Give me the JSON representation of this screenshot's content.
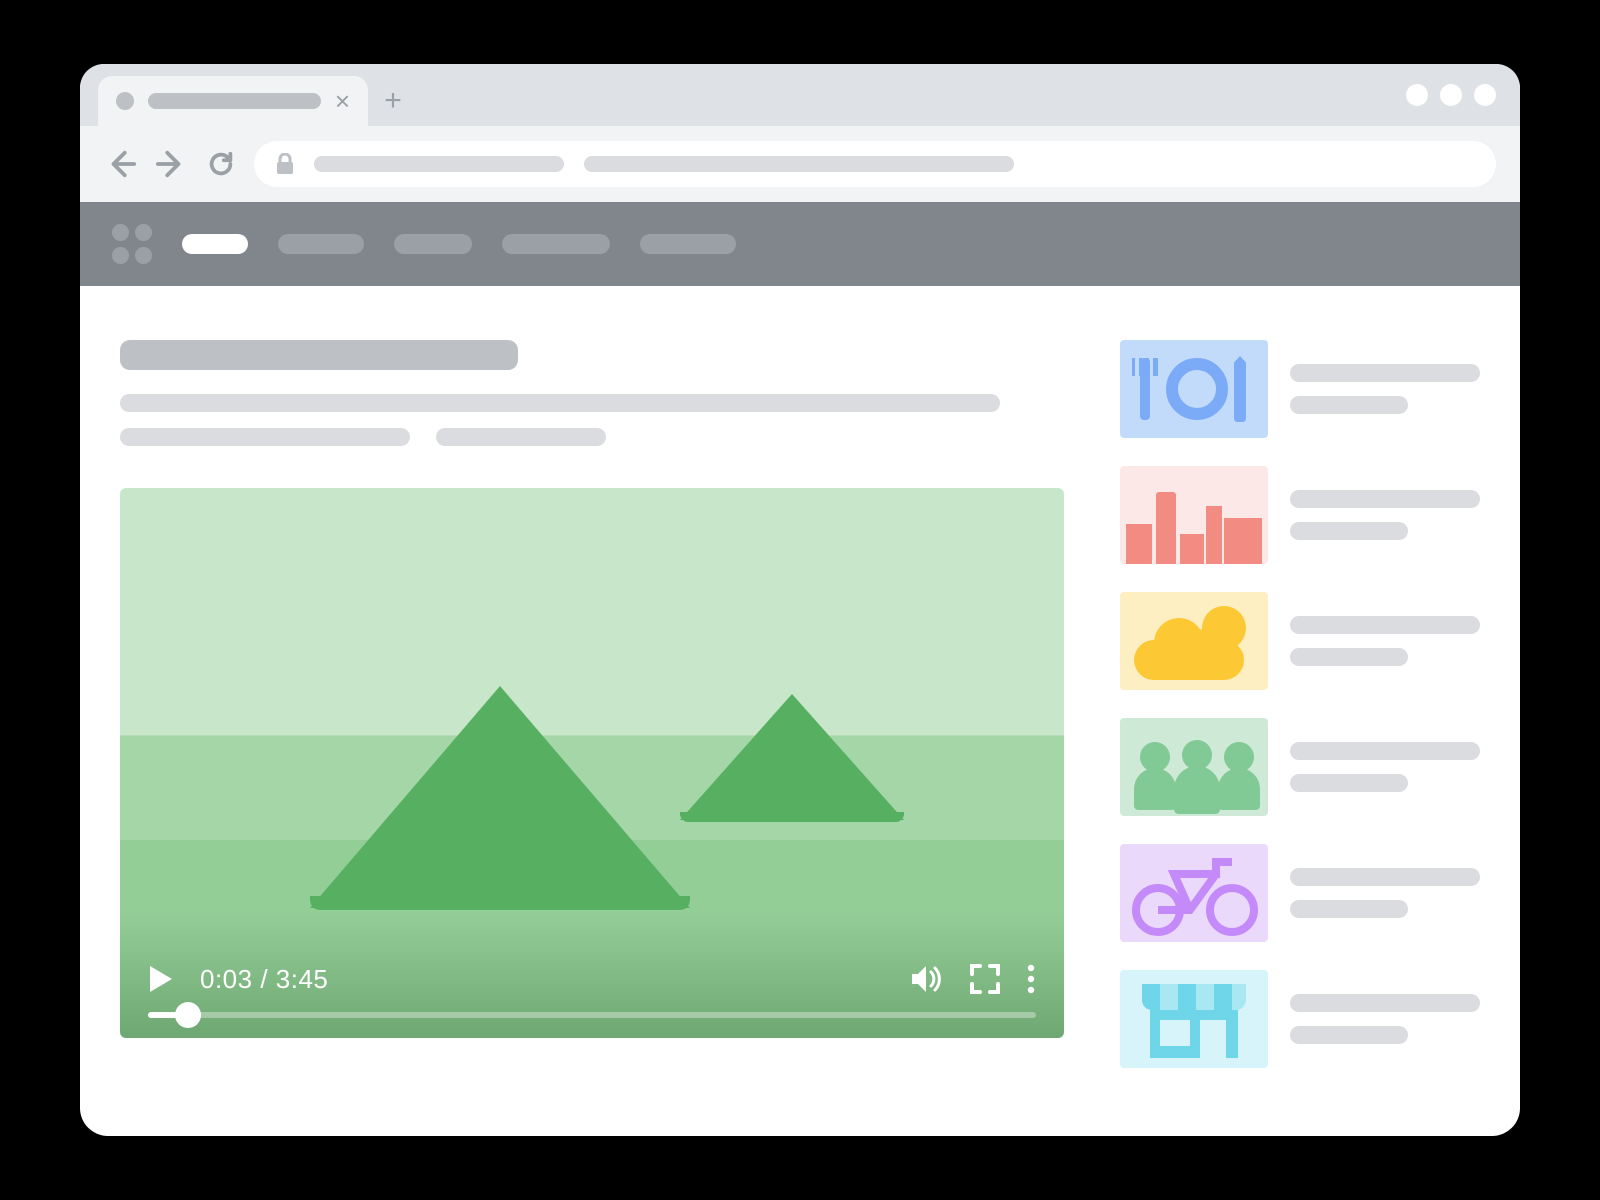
{
  "browser": {
    "tab": {
      "favicon": "dot",
      "title_placeholder": "",
      "close_label": "×"
    },
    "new_tab_label": "+",
    "window_controls": [
      "min",
      "max",
      "close"
    ],
    "nav": {
      "back": "←",
      "forward": "→",
      "reload": "⟳"
    },
    "omnibox": {
      "secure": true,
      "url_segment_1": "",
      "url_segment_2": ""
    }
  },
  "site": {
    "logo": "grid-2x2",
    "nav_items": [
      {
        "active": true
      },
      {
        "active": false
      },
      {
        "active": false
      },
      {
        "active": false
      },
      {
        "active": false
      }
    ]
  },
  "article": {
    "title": "",
    "lines": [
      "",
      "",
      "",
      ""
    ]
  },
  "player": {
    "artwork": "green-hills",
    "playing": false,
    "current_time": "0:03",
    "duration": "3:45",
    "time_display": "0:03 / 3:45",
    "progress_pct": 4,
    "volume_muted": false
  },
  "sidebar_cards": [
    {
      "thumb": "food",
      "icon_name": "utensils-plate-icon",
      "line1": "",
      "line2": ""
    },
    {
      "thumb": "city",
      "icon_name": "city-skyline-icon",
      "line1": "",
      "line2": ""
    },
    {
      "thumb": "weather",
      "icon_name": "sun-cloud-icon",
      "line1": "",
      "line2": ""
    },
    {
      "thumb": "people",
      "icon_name": "people-group-icon",
      "line1": "",
      "line2": ""
    },
    {
      "thumb": "bike",
      "icon_name": "bicycle-icon",
      "line1": "",
      "line2": ""
    },
    {
      "thumb": "shop",
      "icon_name": "storefront-icon",
      "line1": "",
      "line2": ""
    }
  ],
  "colors": {
    "chrome_tabstrip": "#DEE1E6",
    "chrome_toolbar": "#F1F3F4",
    "site_header": "#80868B",
    "placeholder": "#BDC1C6",
    "placeholder_lt": "#DADCE0",
    "hill_green": "#57B062"
  }
}
